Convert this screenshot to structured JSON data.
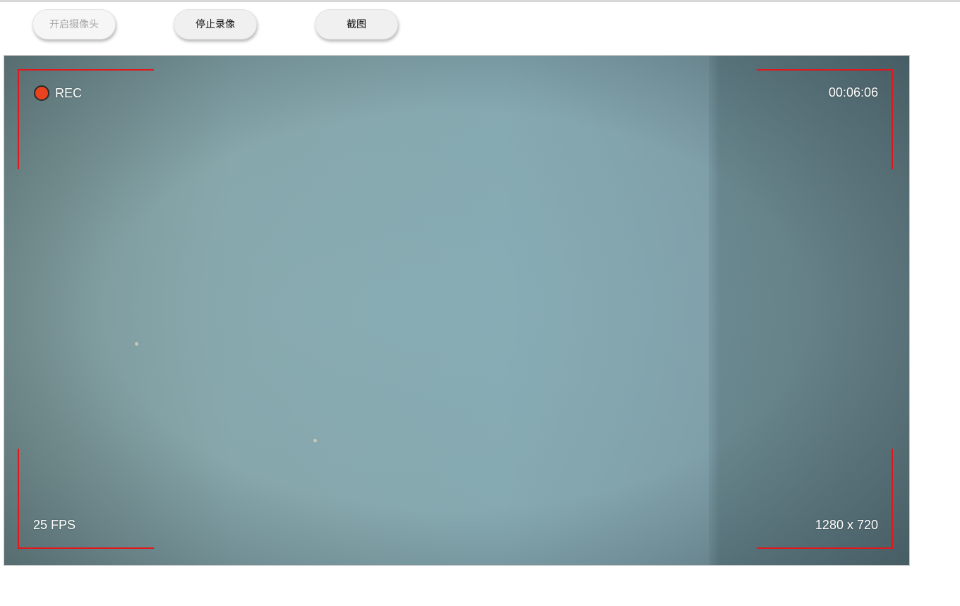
{
  "toolbar": {
    "open_camera_label": "开启摄像头",
    "stop_recording_label": "停止录像",
    "screenshot_label": "截图"
  },
  "viewfinder": {
    "rec_label": "REC",
    "timer": "00:06:06",
    "fps": "25 FPS",
    "resolution": "1280 x 720"
  },
  "colors": {
    "rec_dot": "#e8431f",
    "corner_brackets": "#e0181b"
  }
}
